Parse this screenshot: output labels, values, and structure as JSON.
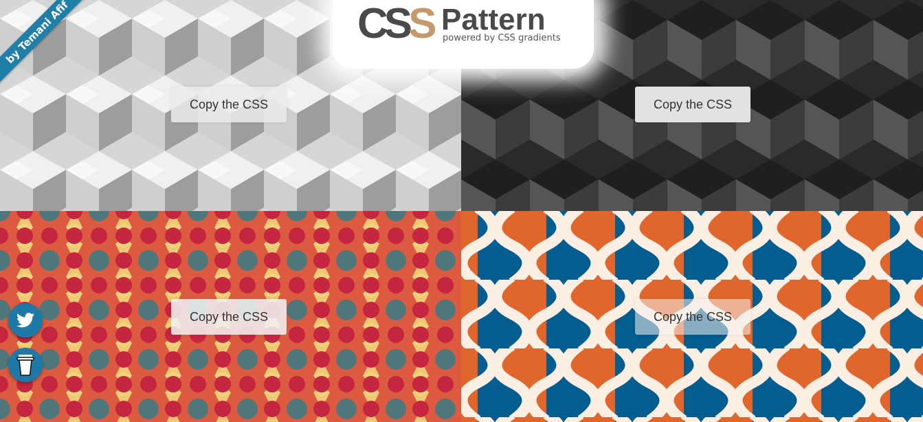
{
  "logo": {
    "css_text_a": "CS",
    "css_text_s": "S",
    "pattern_text": "Pattern",
    "tagline": "powered by CSS gradients"
  },
  "ribbon": {
    "prefix": "by",
    "author": "Temani Afif"
  },
  "tiles": [
    {
      "button_label": "Copy the CSS",
      "colors": [
        "#f0f0f0",
        "#cfcfcf",
        "#9d9d9d"
      ]
    },
    {
      "button_label": "Copy the CSS",
      "colors": [
        "#1f1f1f",
        "#3c3c3c",
        "#555555"
      ]
    },
    {
      "button_label": "Copy the CSS",
      "colors": [
        "#dc5b40",
        "#f0d47a",
        "#c4253f",
        "#4f767b"
      ]
    },
    {
      "button_label": "Copy the CSS",
      "colors": [
        "#035d8f",
        "#fbeee3",
        "#e0662c"
      ]
    }
  ],
  "floating": {
    "twitter_icon": "twitter-icon",
    "coffee_icon": "coffee-cup-icon"
  },
  "accent": "#1f7fa8"
}
